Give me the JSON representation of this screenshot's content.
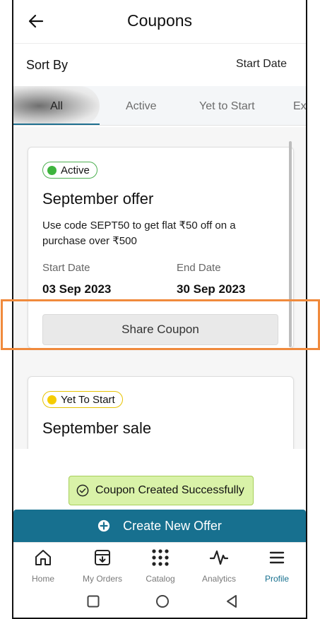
{
  "header": {
    "title": "Coupons",
    "back_icon": "arrow-left-icon"
  },
  "sort": {
    "label": "Sort By",
    "value": "Start Date"
  },
  "tabs": [
    {
      "label": "All",
      "selected": true
    },
    {
      "label": "Active",
      "selected": false
    },
    {
      "label": "Yet to Start",
      "selected": false
    },
    {
      "label": "Ex",
      "selected": false
    }
  ],
  "coupons": [
    {
      "status": "Active",
      "status_color": "#3db43d",
      "title": "September offer",
      "description": "Use code SEPT50 to get flat ₹50 off on a purchase over ₹500",
      "start_label": "Start Date",
      "start_value": "03 Sep 2023",
      "end_label": "End Date",
      "end_value": "30 Sep 2023",
      "share_label": "Share Coupon"
    },
    {
      "status": "Yet To Start",
      "status_color": "#f5cc00",
      "title": "September sale"
    }
  ],
  "toast": {
    "message": "Coupon Created Successfully",
    "icon": "check-circle-icon"
  },
  "create_button": {
    "label": "Create New Offer",
    "icon": "plus-circle-icon"
  },
  "bottom_nav": [
    {
      "label": "Home",
      "icon": "home-icon"
    },
    {
      "label": "My Orders",
      "icon": "orders-icon"
    },
    {
      "label": "Catalog",
      "icon": "grid-icon"
    },
    {
      "label": "Analytics",
      "icon": "analytics-icon"
    },
    {
      "label": "Profile",
      "icon": "menu-icon",
      "active": true
    }
  ],
  "colors": {
    "accent": "#17708f",
    "toast_bg": "#d9f2a8",
    "highlight": "#f08a3c"
  }
}
